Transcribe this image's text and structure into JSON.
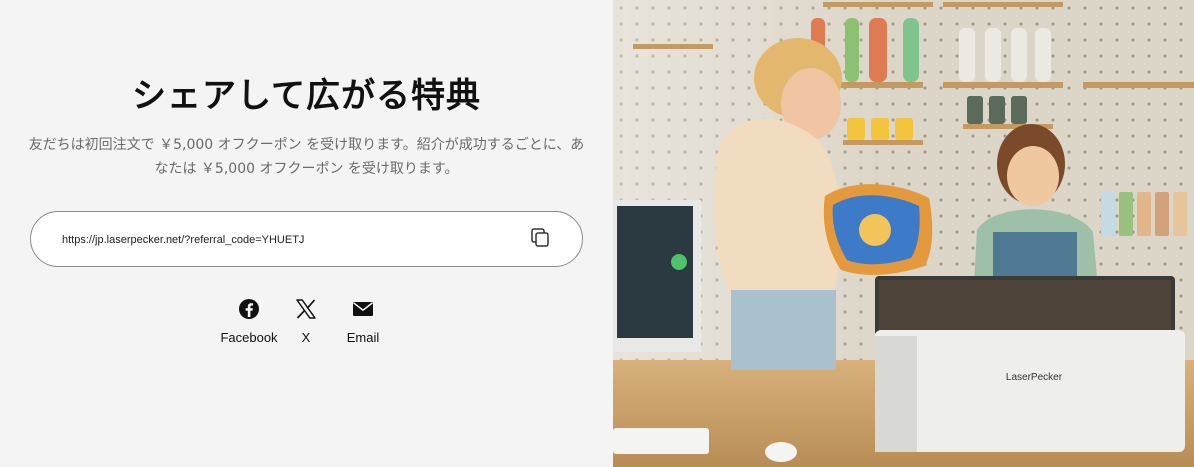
{
  "share_panel": {
    "title": "シェアして広がる特典",
    "description_line1": "友だちは初回注文で ￥5,000 オフクーポン を受け取ります。紹介が成功するごとに、あ",
    "description_line2": "なたは ￥5,000 オフクーポン を受け取ります。",
    "referral_link": "https://jp.laserpecker.net/?referral_code=YHUETJ",
    "copy_icon": "copy-icon",
    "channels": [
      {
        "label": "Facebook",
        "icon": "facebook-icon"
      },
      {
        "label": "X",
        "icon": "x-icon"
      },
      {
        "label": "Email",
        "icon": "email-icon"
      }
    ]
  },
  "hero_image": {
    "device_brand": "LaserPecker"
  },
  "colors": {
    "panel_bg": "#f4f4f4",
    "text_primary": "#111111",
    "text_secondary": "#6a6a6a",
    "border": "#8a8a8a"
  }
}
